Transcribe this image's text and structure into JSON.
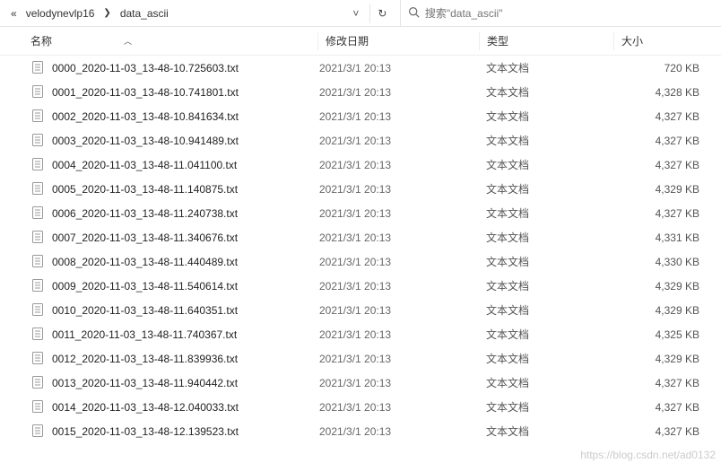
{
  "breadcrumb": {
    "prefix": "«",
    "parent": "velodynevlp16",
    "current": "data_ascii"
  },
  "search": {
    "placeholder": "搜索\"data_ascii\""
  },
  "columns": {
    "name": "名称",
    "date": "修改日期",
    "type": "类型",
    "size": "大小"
  },
  "files": [
    {
      "name": "0000_2020-11-03_13-48-10.725603.txt",
      "date": "2021/3/1 20:13",
      "type": "文本文档",
      "size": "720 KB"
    },
    {
      "name": "0001_2020-11-03_13-48-10.741801.txt",
      "date": "2021/3/1 20:13",
      "type": "文本文档",
      "size": "4,328 KB"
    },
    {
      "name": "0002_2020-11-03_13-48-10.841634.txt",
      "date": "2021/3/1 20:13",
      "type": "文本文档",
      "size": "4,327 KB"
    },
    {
      "name": "0003_2020-11-03_13-48-10.941489.txt",
      "date": "2021/3/1 20:13",
      "type": "文本文档",
      "size": "4,327 KB"
    },
    {
      "name": "0004_2020-11-03_13-48-11.041100.txt",
      "date": "2021/3/1 20:13",
      "type": "文本文档",
      "size": "4,327 KB"
    },
    {
      "name": "0005_2020-11-03_13-48-11.140875.txt",
      "date": "2021/3/1 20:13",
      "type": "文本文档",
      "size": "4,329 KB"
    },
    {
      "name": "0006_2020-11-03_13-48-11.240738.txt",
      "date": "2021/3/1 20:13",
      "type": "文本文档",
      "size": "4,327 KB"
    },
    {
      "name": "0007_2020-11-03_13-48-11.340676.txt",
      "date": "2021/3/1 20:13",
      "type": "文本文档",
      "size": "4,331 KB"
    },
    {
      "name": "0008_2020-11-03_13-48-11.440489.txt",
      "date": "2021/3/1 20:13",
      "type": "文本文档",
      "size": "4,330 KB"
    },
    {
      "name": "0009_2020-11-03_13-48-11.540614.txt",
      "date": "2021/3/1 20:13",
      "type": "文本文档",
      "size": "4,329 KB"
    },
    {
      "name": "0010_2020-11-03_13-48-11.640351.txt",
      "date": "2021/3/1 20:13",
      "type": "文本文档",
      "size": "4,329 KB"
    },
    {
      "name": "0011_2020-11-03_13-48-11.740367.txt",
      "date": "2021/3/1 20:13",
      "type": "文本文档",
      "size": "4,325 KB"
    },
    {
      "name": "0012_2020-11-03_13-48-11.839936.txt",
      "date": "2021/3/1 20:13",
      "type": "文本文档",
      "size": "4,329 KB"
    },
    {
      "name": "0013_2020-11-03_13-48-11.940442.txt",
      "date": "2021/3/1 20:13",
      "type": "文本文档",
      "size": "4,327 KB"
    },
    {
      "name": "0014_2020-11-03_13-48-12.040033.txt",
      "date": "2021/3/1 20:13",
      "type": "文本文档",
      "size": "4,327 KB"
    },
    {
      "name": "0015_2020-11-03_13-48-12.139523.txt",
      "date": "2021/3/1 20:13",
      "type": "文本文档",
      "size": "4,327 KB"
    }
  ],
  "watermark": "https://blog.csdn.net/ad0132"
}
